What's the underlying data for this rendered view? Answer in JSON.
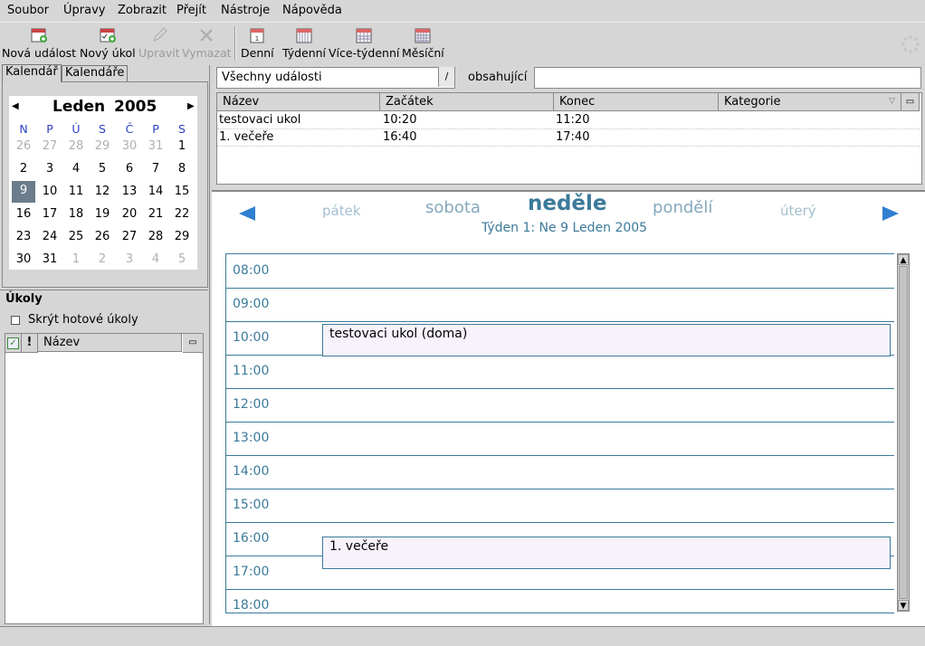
{
  "menu": [
    "Soubor",
    "Úpravy",
    "Zobrazit",
    "Přejít",
    "Nástroje",
    "Nápověda"
  ],
  "toolbar": {
    "new_event": "Nová událost",
    "new_task": "Nový úkol",
    "edit": "Upravit",
    "delete": "Vymazat",
    "day": "Denní",
    "week": "Týdenní",
    "multiweek": "Více-týdenní",
    "month": "Měsíční"
  },
  "tabs": {
    "calendar": "Kalendář",
    "calendars": "Kalendáře"
  },
  "minical": {
    "month": "Leden",
    "year": "2005",
    "dow": [
      "N",
      "P",
      "Ú",
      "S",
      "Č",
      "P",
      "S"
    ],
    "weeks": [
      [
        "26",
        "27",
        "28",
        "29",
        "30",
        "31",
        "1"
      ],
      [
        "2",
        "3",
        "4",
        "5",
        "6",
        "7",
        "8"
      ],
      [
        "9",
        "10",
        "11",
        "12",
        "13",
        "14",
        "15"
      ],
      [
        "16",
        "17",
        "18",
        "19",
        "20",
        "21",
        "22"
      ],
      [
        "23",
        "24",
        "25",
        "26",
        "27",
        "28",
        "29"
      ],
      [
        "30",
        "31",
        "1",
        "2",
        "3",
        "4",
        "5"
      ]
    ],
    "selected": "9"
  },
  "tasks": {
    "title": "Úkoly",
    "hide_done": "Skrýt hotové úkoly",
    "col_done": "✓",
    "col_priority": "!",
    "col_name": "Název"
  },
  "filter": {
    "selected": "Všechny události",
    "contains_label": "obsahující",
    "search_value": ""
  },
  "events_list": {
    "columns": [
      "Název",
      "Začátek",
      "Konec",
      "Kategorie"
    ],
    "rows": [
      [
        "testovaci ukol",
        "10:20",
        "11:20",
        ""
      ],
      [
        "1. večeře",
        "16:40",
        "17:40",
        ""
      ]
    ]
  },
  "dayview": {
    "prev2": "pátek",
    "prev1": "sobota",
    "current": "neděle",
    "next1": "pondělí",
    "next2": "úterý",
    "week_label": "Týden 1: Ne 9 Leden 2005",
    "hours": [
      "08:00",
      "09:00",
      "10:00",
      "11:00",
      "12:00",
      "13:00",
      "14:00",
      "15:00",
      "16:00",
      "17:00",
      "18:00"
    ],
    "events": [
      {
        "title": "testovaci ukol (doma)",
        "start": "10:20",
        "end": "11:20"
      },
      {
        "title": "1. večeře",
        "start": "16:40",
        "end": "17:40"
      }
    ]
  },
  "colors": {
    "accent": "#3b7a9a",
    "event_bg": "#f7f2fc",
    "selected_day": "#6b7c8c",
    "arrow": "#2f7fd0"
  }
}
